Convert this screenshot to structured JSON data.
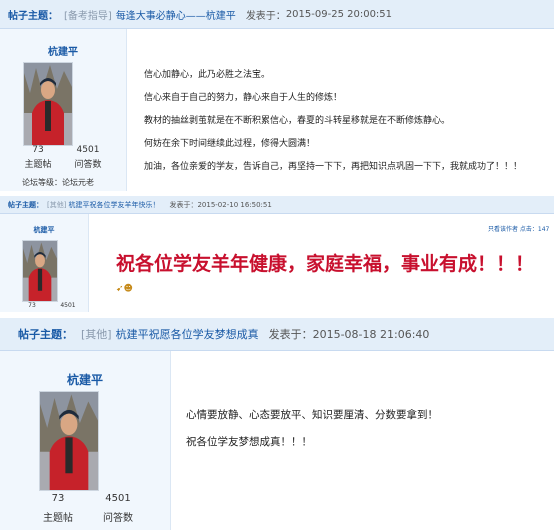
{
  "post1": {
    "header": {
      "topic_label": "帖子主题：",
      "category": "[备考指导]",
      "title": "每逢大事必静心——杭建平",
      "posted_prefix": "发表于：",
      "posted_time": "2015-09-25 20:00:51"
    },
    "author": {
      "name": "杭建平",
      "posts": "73",
      "posts_label": "主题帖",
      "questions": "4501",
      "questions_label": "问答数",
      "level": "论坛等级：论坛元老"
    },
    "content": [
      "信心加静心，此乃必胜之法宝。",
      "信心来自于自己的努力，静心来自于人生的修炼！",
      "教材的抽丝剥茧就是在不断积累信心，春夏的斗转星移就是在不断修炼静心。",
      "何妨在余下时间继续此过程，修得大圆满！",
      "加油，各位亲爱的学友，告诉自己，再坚持一下下，再把知识点巩固一下下，我就成功了！！！"
    ]
  },
  "post2": {
    "header": {
      "topic_label": "帖子主题：",
      "category": "[其他]",
      "title": "杭建平祝各位学友羊年快乐！",
      "posted_prefix": "发表于：",
      "posted_time": "2015-02-10 16:50:51"
    },
    "author": {
      "name": "杭建平",
      "posts": "73",
      "questions": "4501"
    },
    "top_right": "只看该作者  点击：147",
    "content": "祝各位学友羊年健康，家庭幸福，事业有成！！！"
  },
  "post3": {
    "header": {
      "topic_label": "帖子主题：",
      "category": "[其他]",
      "title": "杭建平祝愿各位学友梦想成真",
      "posted_prefix": "发表于：",
      "posted_time": "2015-08-18 21:06:40"
    },
    "author": {
      "name": "杭建平",
      "posts": "73",
      "posts_label": "主题帖",
      "questions": "4501",
      "questions_label": "问答数"
    },
    "content": [
      "心情要放静、心态要放平、知识要厘清、分数要拿到！",
      "祝各位学友梦想成真！！！"
    ]
  }
}
